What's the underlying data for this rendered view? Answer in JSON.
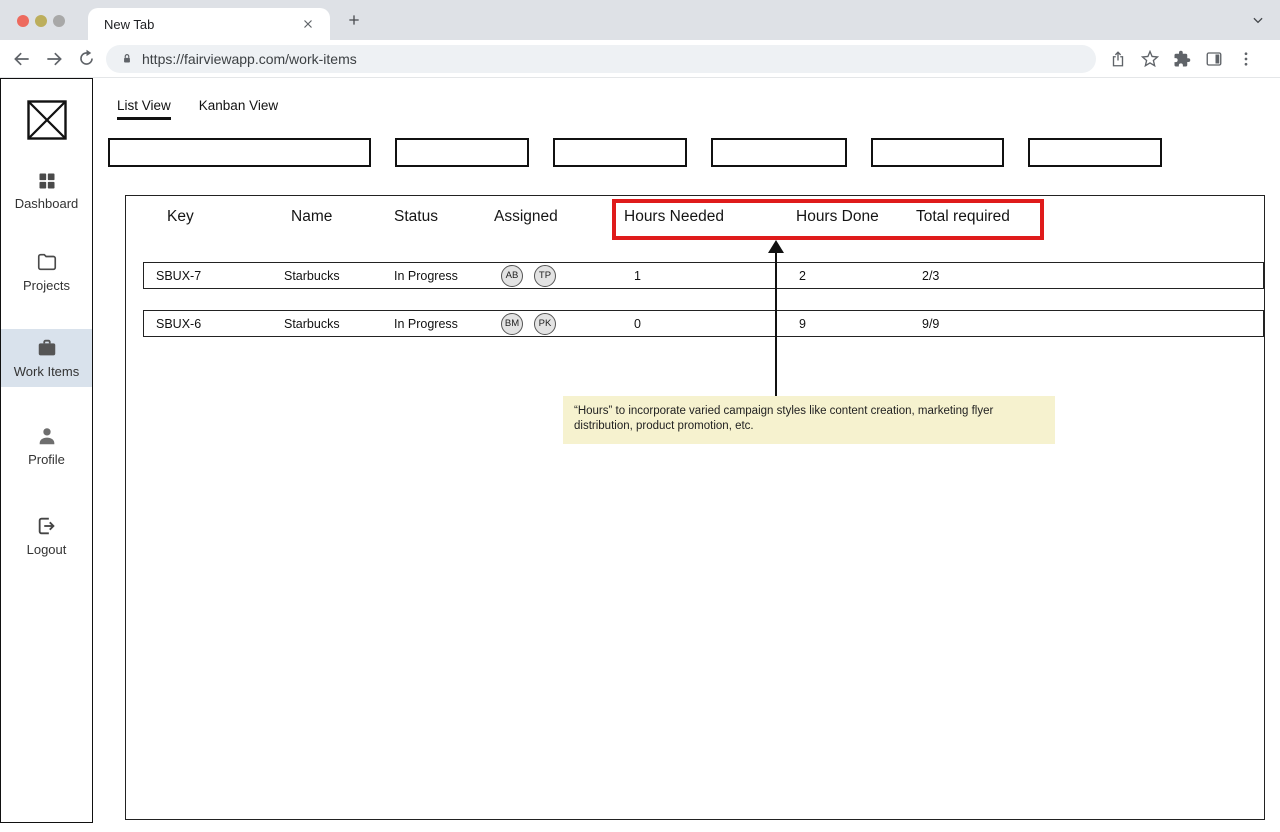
{
  "browser": {
    "tab_title": "New Tab",
    "url": "https://fairviewapp.com/work-items",
    "traffic_light_colors": [
      "#ed6a5e",
      "#bcae5c",
      "#a8a8a8"
    ]
  },
  "sidebar": {
    "items": [
      {
        "label": "Dashboard",
        "active": false
      },
      {
        "label": "Projects",
        "active": false
      },
      {
        "label": "Work Items",
        "active": true
      },
      {
        "label": "Profile",
        "active": false
      },
      {
        "label": "Logout",
        "active": false
      }
    ],
    "active_item_bg": "#d9e2ec"
  },
  "view_tabs": [
    {
      "label": "List View",
      "active": true
    },
    {
      "label": "Kanban View",
      "active": false
    }
  ],
  "filters": {
    "box_count": 6
  },
  "table": {
    "headers": [
      "Key",
      "Name",
      "Status",
      "Assigned",
      "Hours Needed",
      "Hours Done",
      "Total required"
    ],
    "rows": [
      {
        "key": "SBUX-7",
        "name": "Starbucks",
        "status": "In Progress",
        "assigned": [
          "AB",
          "TP"
        ],
        "hours_needed": "1",
        "hours_done": "2",
        "total_required": "2/3"
      },
      {
        "key": "SBUX-6",
        "name": "Starbucks",
        "status": "In Progress",
        "assigned": [
          "BM",
          "PK"
        ],
        "hours_needed": "0",
        "hours_done": "9",
        "total_required": "9/9"
      }
    ]
  },
  "annotation": {
    "note_text": "“Hours” to incorporate varied campaign styles like content creation, marketing flyer distribution, product promotion, etc.",
    "highlight_color": "#df1b1b",
    "note_bg_color": "#f6f2cf"
  }
}
